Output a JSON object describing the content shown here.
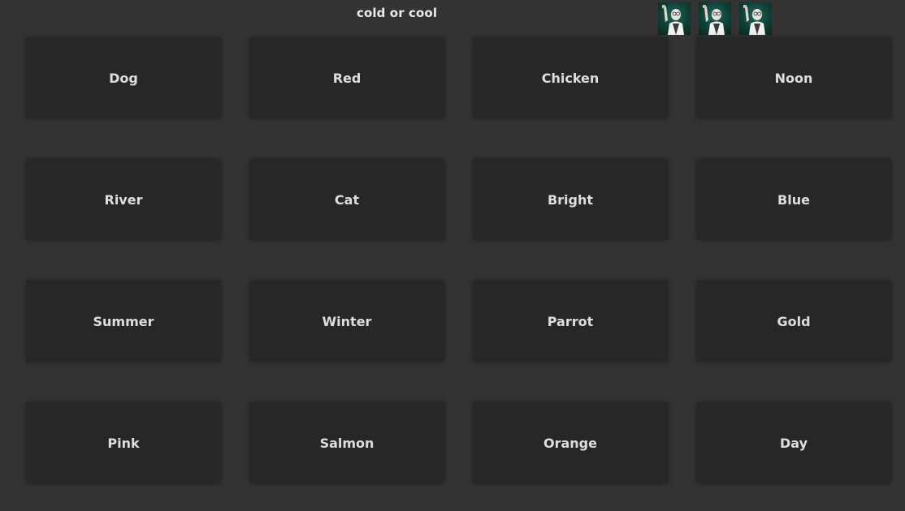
{
  "hint": "cold or cool",
  "lives": {
    "count": 3,
    "icon": "mascot-icon",
    "icon_bg": "#0f3f36"
  },
  "tiles": [
    "Dog",
    "Red",
    "Chicken",
    "Noon",
    "River",
    "Cat",
    "Bright",
    "Blue",
    "Summer",
    "Winter",
    "Parrot",
    "Gold",
    "Pink",
    "Salmon",
    "Orange",
    "Day"
  ],
  "colors": {
    "background": "#333333",
    "tile": "#272727",
    "text": "#dedede"
  }
}
